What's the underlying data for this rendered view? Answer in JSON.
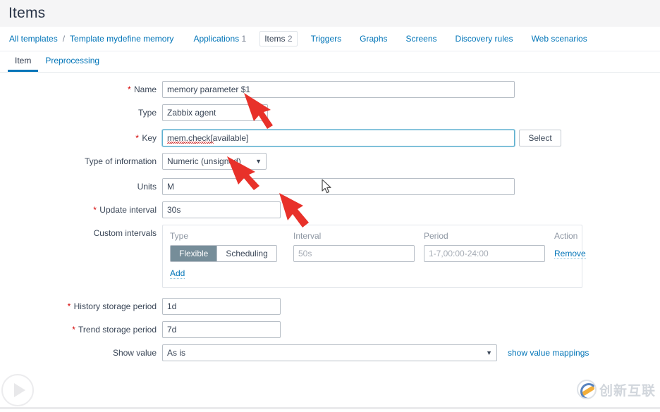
{
  "header": {
    "title": "Items"
  },
  "breadcrumb": {
    "all_templates": "All templates",
    "separator": "/",
    "template_name": "Template mydefine memory",
    "items": [
      {
        "label": "Applications",
        "count": "1",
        "selected": false
      },
      {
        "label": "Items",
        "count": "2",
        "selected": true
      },
      {
        "label": "Triggers",
        "count": "",
        "selected": false
      },
      {
        "label": "Graphs",
        "count": "",
        "selected": false
      },
      {
        "label": "Screens",
        "count": "",
        "selected": false
      },
      {
        "label": "Discovery rules",
        "count": "",
        "selected": false
      },
      {
        "label": "Web scenarios",
        "count": "",
        "selected": false
      }
    ]
  },
  "form_tabs": [
    {
      "label": "Item",
      "active": true
    },
    {
      "label": "Preprocessing",
      "active": false
    }
  ],
  "form": {
    "name": {
      "label": "Name",
      "required": "*",
      "value": "memory parameter $1",
      "placeholder": ""
    },
    "type": {
      "label": "Type",
      "value": "Zabbix agent"
    },
    "key": {
      "label": "Key",
      "required": "*",
      "value": "mem.check[available]",
      "placeholder": "",
      "select_button": "Select"
    },
    "type_of_information": {
      "label": "Type of information",
      "value": "Numeric (unsigned)"
    },
    "units": {
      "label": "Units",
      "value": "M",
      "placeholder": ""
    },
    "update_interval": {
      "label": "Update interval",
      "required": "*",
      "value": "30s",
      "placeholder": ""
    },
    "custom_intervals": {
      "label": "Custom intervals",
      "columns": {
        "type": "Type",
        "interval": "Interval",
        "period": "Period",
        "action": "Action"
      },
      "rows": [
        {
          "type_flexible": "Flexible",
          "type_scheduling": "Scheduling",
          "type_selected": "Flexible",
          "interval_value": "",
          "interval_placeholder": "50s",
          "period_value": "",
          "period_placeholder": "1-7,00:00-24:00",
          "action_label": "Remove"
        }
      ],
      "add_label": "Add"
    },
    "history_storage_period": {
      "label": "History storage period",
      "required": "*",
      "value": "1d",
      "placeholder": ""
    },
    "trend_storage_period": {
      "label": "Trend storage period",
      "required": "*",
      "value": "7d",
      "placeholder": ""
    },
    "show_value": {
      "label": "Show value",
      "value": "As is",
      "mappings_link": "show value mappings"
    }
  },
  "watermark": {
    "text": "创新互联"
  },
  "colors": {
    "link": "#0275b8",
    "required": "#d40000",
    "active_tab_underline": "#0275b8",
    "segment_selected_bg": "#768d99",
    "annotation_arrow": "#e8312a",
    "page_header_bg": "#f5f5f6"
  }
}
